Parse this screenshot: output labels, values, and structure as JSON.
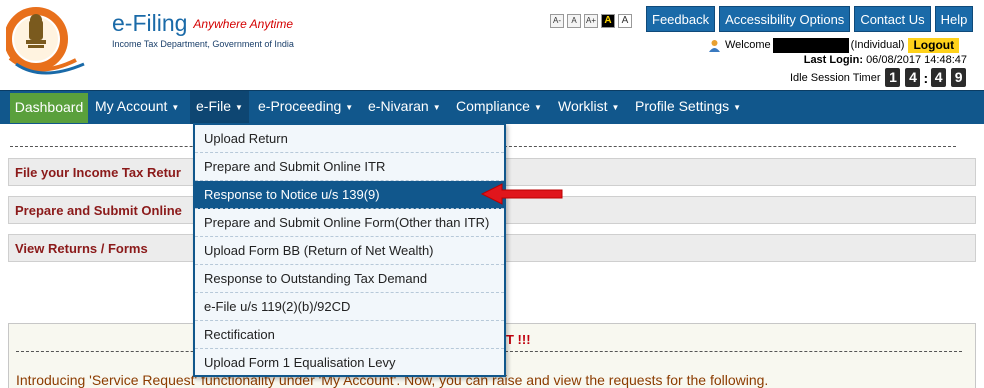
{
  "header": {
    "brand_title": "e-Filing",
    "brand_tagline": "Anywhere Anytime",
    "department": "Income Tax Department, Government of India",
    "font_size_buttons": [
      "A-",
      "A",
      "A+",
      "A",
      "A"
    ],
    "top_buttons": [
      "Feedback",
      "Accessibility Options",
      "Contact Us",
      "Help"
    ],
    "welcome_label": "Welcome",
    "user_type": "(Individual)",
    "logout_label": "Logout",
    "last_login_label": "Last Login:",
    "last_login_value": "06/08/2017 14:48:47",
    "idle_label": "Idle Session Timer",
    "idle_digits": [
      "1",
      "4",
      "4",
      "9"
    ]
  },
  "nav": {
    "items": [
      {
        "label": "Dashboard"
      },
      {
        "label": "My Account"
      },
      {
        "label": "e-File"
      },
      {
        "label": "e-Proceeding"
      },
      {
        "label": "e-Nivaran"
      },
      {
        "label": "Compliance"
      },
      {
        "label": "Worklist"
      },
      {
        "label": "Profile Settings"
      }
    ]
  },
  "efile_menu": {
    "items": [
      "Upload Return",
      "Prepare and Submit Online ITR",
      "Response to Notice u/s 139(9)",
      "Prepare and Submit Online Form(Other than ITR)",
      "Upload Form BB (Return of Net Wealth)",
      "Response to Outstanding Tax Demand",
      "e-File u/s 119(2)(b)/92CD",
      "Rectification",
      "Upload Form 1 Equalisation Levy"
    ],
    "selected_index": 2
  },
  "sections": [
    "File your Income Tax Retur",
    "Prepare and Submit Online",
    "View Returns / Forms"
  ],
  "notice": {
    "alert_suffix": "T !!!",
    "intro": "Introducing 'Service Request' functionality under 'My Account'. Now, you can raise and view the requests for the following."
  },
  "colors": {
    "nav_blue": "#11578c",
    "dashboard_green": "#5aa03c",
    "section_text": "#8b1a1a",
    "alert_red": "#c0000d",
    "logout_yellow": "#ffd21a"
  }
}
